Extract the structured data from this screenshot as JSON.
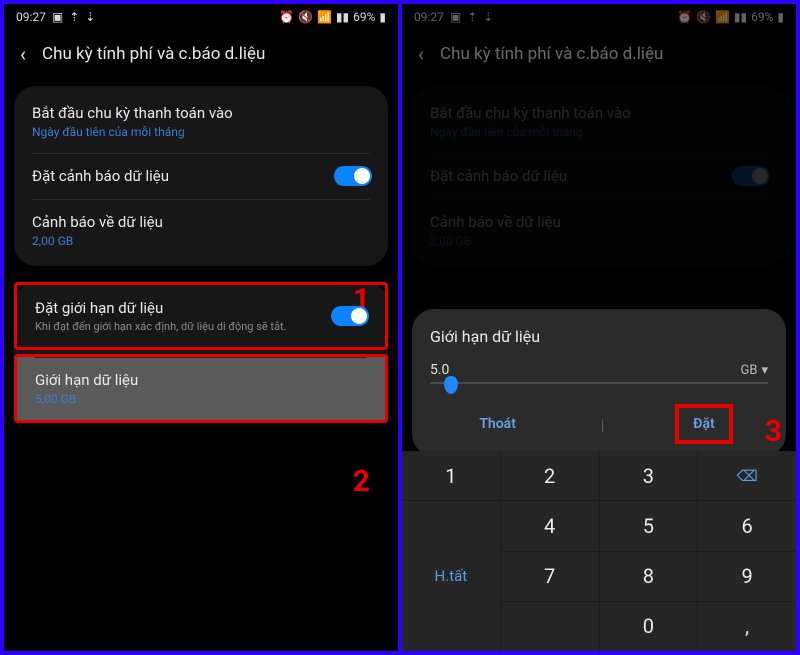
{
  "statusbar": {
    "time": "09:27",
    "battery": "69%"
  },
  "header": {
    "title": "Chu kỳ tính phí và c.báo d.liệu"
  },
  "rows": {
    "billing": {
      "title": "Bắt đầu chu kỳ thanh toán vào",
      "sub": "Ngày đầu tiên của mỗi tháng"
    },
    "setWarning": {
      "title": "Đặt cảnh báo dữ liệu"
    },
    "warning": {
      "title": "Cảnh báo về dữ liệu",
      "sub": "2,00 GB"
    },
    "setLimit": {
      "title": "Đặt giới hạn dữ liệu",
      "desc": "Khi đạt đến giới hạn xác định, dữ liệu di động sẽ tắt."
    },
    "limit": {
      "title": "Giới hạn dữ liệu",
      "sub": "5,00 GB"
    }
  },
  "anno": {
    "one": "1",
    "two": "2",
    "three": "3"
  },
  "dialog": {
    "title": "Giới hạn dữ liệu",
    "value": "5.0",
    "unit": "GB",
    "cancel": "Thoát",
    "confirm": "Đặt"
  },
  "keypad": {
    "k1": "1",
    "k2": "2",
    "k3": "3",
    "back": "⌫",
    "k4": "4",
    "k5": "5",
    "k6": "6",
    "k7": "7",
    "k8": "8",
    "k9": "9",
    "comma": ",",
    "k0": "0",
    "done": "H.tất"
  }
}
